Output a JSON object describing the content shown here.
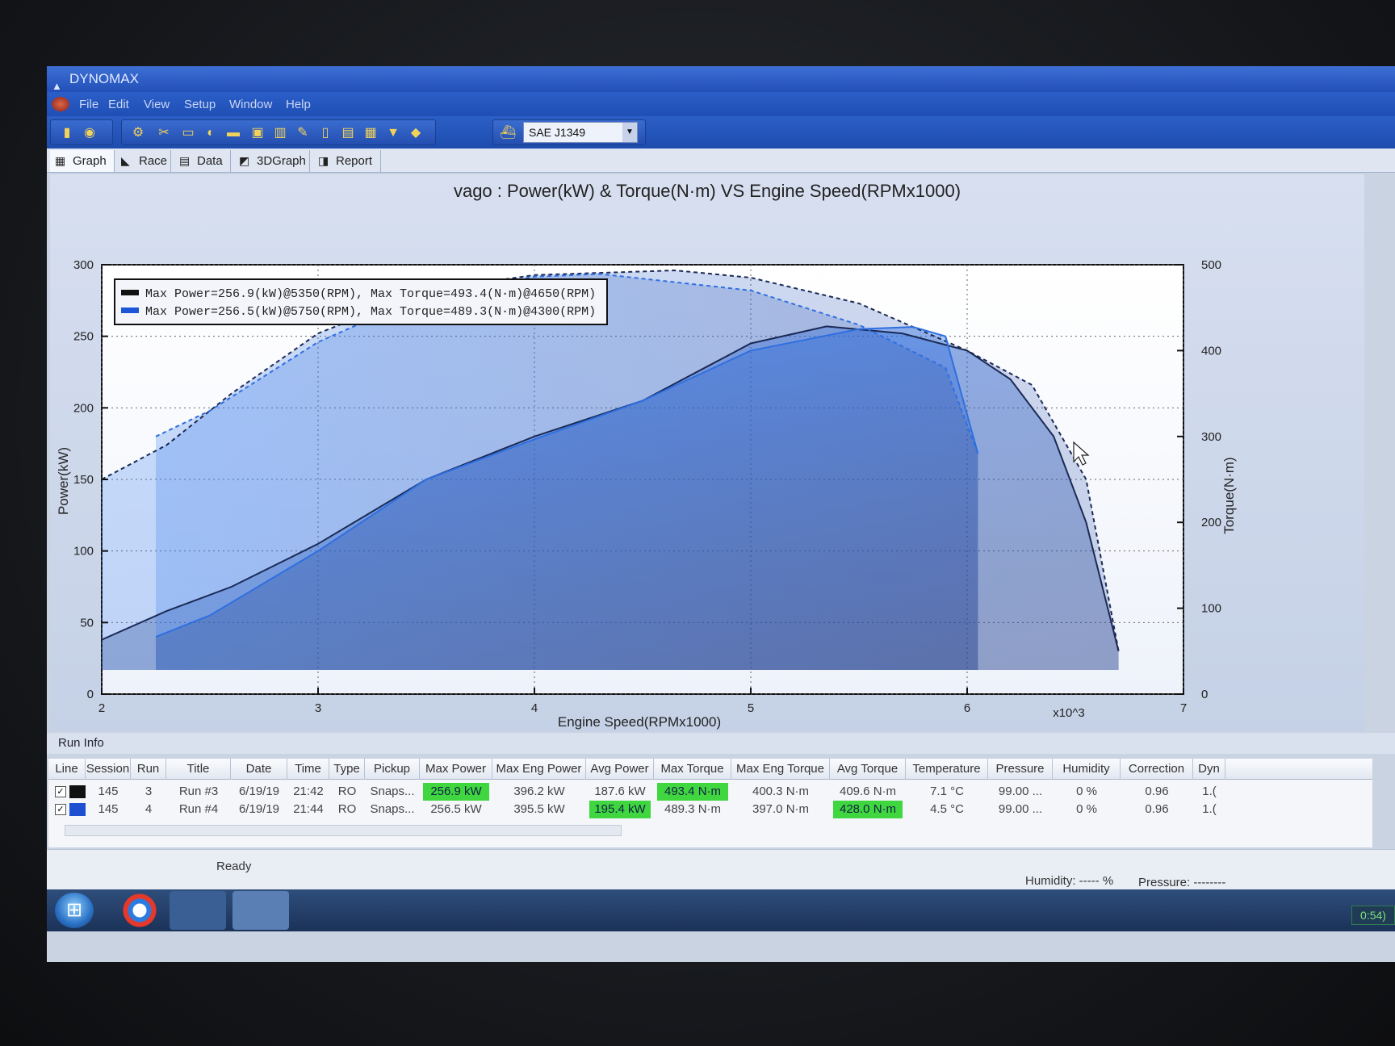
{
  "window": {
    "title": "DYNOMAX"
  },
  "menu": [
    "File",
    "Edit",
    "View",
    "Setup",
    "Window",
    "Help"
  ],
  "toolbar": {
    "correction_standard": "SAE J1349"
  },
  "tabs": [
    "Graph",
    "Race",
    "Data",
    "3DGraph",
    "Report"
  ],
  "chart_data": {
    "type": "line",
    "title": "vago : Power(kW) & Torque(N·m) VS Engine Speed(RPMx1000)",
    "xlabel": "Engine Speed(RPMx1000)",
    "x_multiplier_label": "x10^3",
    "ylabel_left": "Power(kW)",
    "ylabel_right": "Torque(N·m)",
    "xlim": [
      2,
      7
    ],
    "ylim_left": [
      0,
      300
    ],
    "ylim_right": [
      0,
      500
    ],
    "x_ticks": [
      "2",
      "3",
      "4",
      "5",
      "6",
      "7"
    ],
    "y_left_ticks": [
      "0",
      "50",
      "100",
      "150",
      "200",
      "250",
      "300"
    ],
    "y_right_ticks": [
      "0",
      "100",
      "200",
      "300",
      "400",
      "500"
    ],
    "legend_position": "top-left",
    "grid": true,
    "legend": [
      "Max Power=256.9(kW)@5350(RPM), Max Torque=493.4(N·m)@4650(RPM)",
      "Max Power=256.5(kW)@5750(RPM), Max Torque=489.3(N·m)@4300(RPM)"
    ],
    "series": [
      {
        "kind": "power",
        "color": "#1a2a55",
        "x": [
          2.0,
          2.3,
          2.6,
          3.0,
          3.5,
          4.0,
          4.5,
          5.0,
          5.35,
          5.7,
          6.0,
          6.2,
          6.4,
          6.55,
          6.7
        ],
        "values": [
          38,
          58,
          75,
          105,
          150,
          180,
          205,
          245,
          256.9,
          252,
          240,
          220,
          180,
          120,
          30
        ]
      },
      {
        "kind": "torque",
        "color": "#1a2a55",
        "dashed": true,
        "x": [
          2.0,
          2.3,
          2.6,
          3.0,
          3.5,
          4.0,
          4.65,
          5.0,
          5.5,
          6.0,
          6.3,
          6.55,
          6.7
        ],
        "values": [
          250,
          290,
          350,
          420,
          470,
          488,
          493.4,
          485,
          455,
          400,
          360,
          250,
          50
        ]
      },
      {
        "kind": "power",
        "color": "#2f6fe0",
        "x": [
          2.25,
          2.5,
          3.0,
          3.5,
          4.0,
          4.5,
          5.0,
          5.5,
          5.75,
          5.9,
          6.05
        ],
        "values": [
          40,
          55,
          100,
          150,
          178,
          205,
          240,
          255,
          256.5,
          250,
          168
        ]
      },
      {
        "kind": "torque",
        "color": "#2f6fe0",
        "dashed": true,
        "x": [
          2.25,
          2.5,
          3.0,
          3.5,
          4.0,
          4.3,
          5.0,
          5.5,
          5.9,
          6.05
        ],
        "values": [
          300,
          330,
          410,
          465,
          486,
          489.3,
          470,
          430,
          380,
          280
        ]
      }
    ]
  },
  "run_info": {
    "title": "Run Info",
    "columns": [
      "Line",
      "Session",
      "Run",
      "Title",
      "Date",
      "Time",
      "Type",
      "Pickup",
      "Max Power",
      "Max Eng Power",
      "Avg Power",
      "Max Torque",
      "Max Eng Torque",
      "Avg Torque",
      "Temperature",
      "Pressure",
      "Humidity",
      "Correction",
      "Dyn"
    ],
    "rows": [
      {
        "line_color": "#111111",
        "checked": "✓",
        "session": "145",
        "run": "3",
        "title": "Run #3",
        "date": "6/19/19",
        "time": "21:42",
        "type": "RO",
        "pickup": "Snaps...",
        "max_power": "256.9 kW",
        "max_eng_power": "396.2 kW",
        "avg_power": "187.6 kW",
        "max_torque": "493.4 N·m",
        "max_eng_torque": "400.3 N·m",
        "avg_torque": "409.6 N·m",
        "temperature": "7.1 °C",
        "pressure": "99.00 ...",
        "humidity": "0 %",
        "correction": "0.96",
        "dyn": "1.("
      },
      {
        "line_color": "#1d4fd0",
        "checked": "✓",
        "session": "145",
        "run": "4",
        "title": "Run #4",
        "date": "6/19/19",
        "time": "21:44",
        "type": "RO",
        "pickup": "Snaps...",
        "max_power": "256.5 kW",
        "max_eng_power": "395.5 kW",
        "avg_power": "195.4 kW",
        "max_torque": "489.3 N·m",
        "max_eng_torque": "397.0 N·m",
        "avg_torque": "428.0 N·m",
        "temperature": "4.5 °C",
        "pressure": "99.00 ...",
        "humidity": "0 %",
        "correction": "0.96",
        "dyn": "1.("
      }
    ]
  },
  "status": {
    "ready": "Ready",
    "humidity": "Humidity: ----- %",
    "pressure": "Pressure: --------"
  },
  "taskbar": {
    "clock": "0:54)"
  },
  "colors": {
    "highlight": "#3fd63f",
    "title_bar": "#2b5ec8"
  }
}
